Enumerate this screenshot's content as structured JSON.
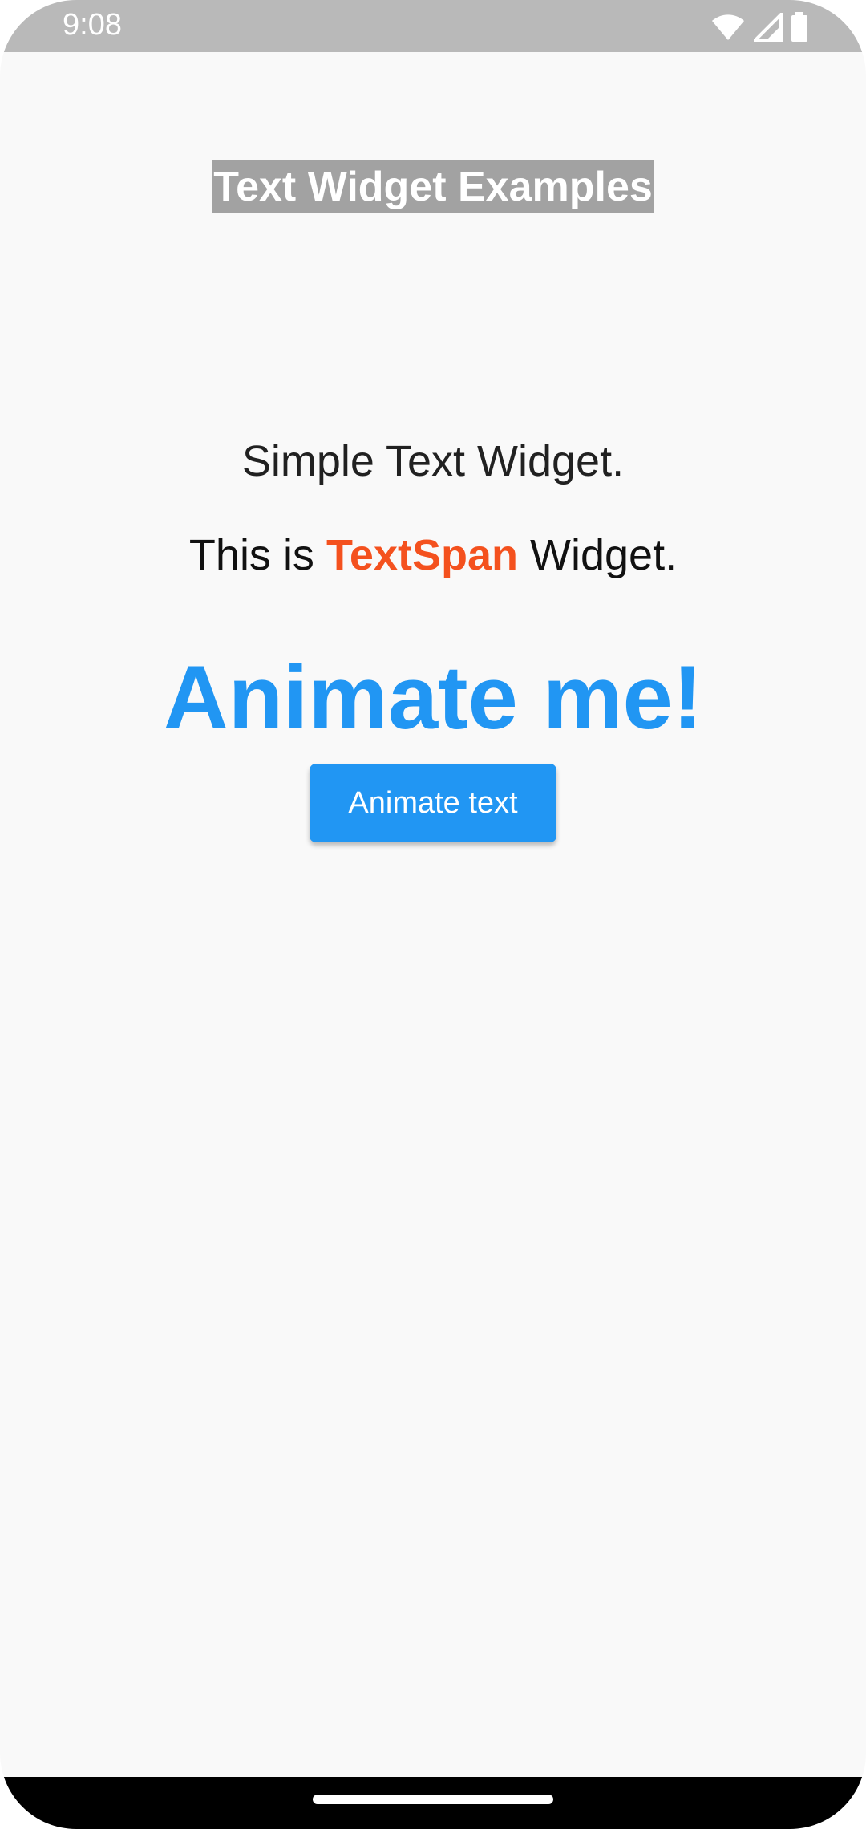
{
  "status_bar": {
    "time": "9:08",
    "icons": [
      "wifi-icon",
      "cellular-signal-icon",
      "battery-icon"
    ]
  },
  "page": {
    "title": "Text Widget Examples",
    "simple_text": "Simple Text Widget.",
    "span_text": {
      "prefix": "This is ",
      "highlight": "TextSpan",
      "suffix": " Widget."
    },
    "animated_text": "Animate me!",
    "animate_button_label": "Animate text"
  },
  "colors": {
    "status_bar": "#b9b9b9",
    "title_background": "#a2a2a2",
    "highlight": "#f4511e",
    "accent": "#2196f3",
    "background": "#f9f9f9"
  }
}
